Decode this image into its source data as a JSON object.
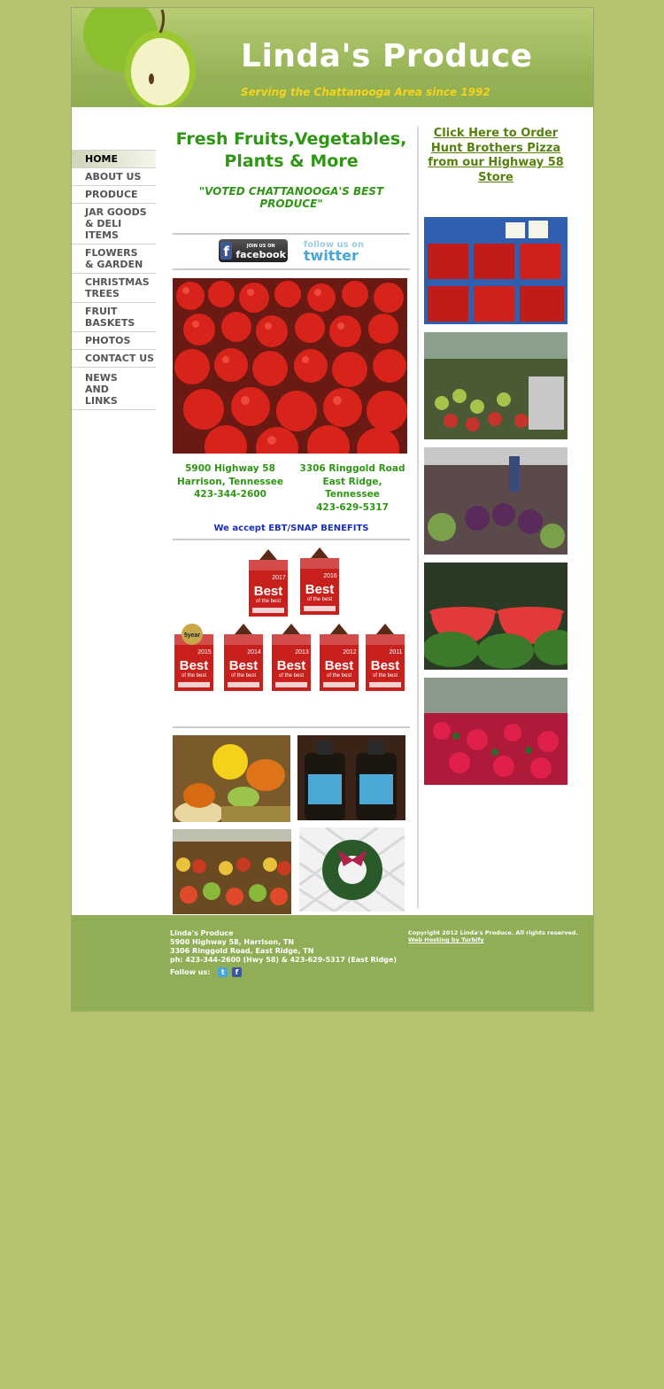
{
  "header": {
    "title": "Linda's Produce",
    "tagline": "Serving the Chattanooga Area since 1992"
  },
  "nav": [
    "HOME",
    "ABOUT US",
    "PRODUCE",
    "JAR GOODS & DELI ITEMS",
    "FLOWERS & GARDEN",
    "CHRISTMAS TREES",
    "FRUIT BASKETS",
    "PHOTOS",
    "CONTACT US",
    "NEWS AND LINKS"
  ],
  "main": {
    "headline_1": "Fresh Fruits,Vegetables,",
    "headline_2": "Plants & More",
    "voted": "\"VOTED CHATTANOOGA'S BEST PRODUCE\"",
    "facebook_small": "JOIN US ON",
    "facebook_label": "facebook",
    "twitter_small": "follow us on",
    "twitter_label": "twitter",
    "store1": {
      "street": "5900 Highway 58",
      "city": "Harrison, Tennessee",
      "phone": "423-344-2600"
    },
    "store2": {
      "street": "3306 Ringgold Road",
      "city": "East Ridge, Tennessee",
      "phone": "423-629-5317"
    },
    "ebt": "We accept EBT/SNAP BENEFITS",
    "badges": [
      "2017",
      "2016",
      "2015",
      "2014",
      "2013",
      "2012",
      "2011"
    ],
    "badge_text_1": "Best",
    "badge_text_2": "of the best",
    "badge_5year": "5year"
  },
  "right": {
    "pizza_link": "Click Here to Order Hunt Brothers Pizza from our Highway 58 Store"
  },
  "footer": {
    "name": "Linda's Produce",
    "addr1": "5900 Highway 58, Harrison, TN",
    "addr2": "3306 Ringgold Road, East Ridge, TN",
    "phones": "ph: 423-344-2600 (Hwy 58) & 423-629-5317 (East Ridge)",
    "follow": "Follow us:",
    "copyright": "Copyright 2012 Linda's Produce. All rights reserved.",
    "hosting": "Web Hosting by Turbify"
  },
  "colors": {
    "green_text": "#2f9614",
    "link_green": "#56800f",
    "tagline_yellow": "#f6d21c",
    "ebt_blue": "#1b2fb8",
    "page_bg": "#b6c36c",
    "footer_bg": "#8fae55"
  }
}
